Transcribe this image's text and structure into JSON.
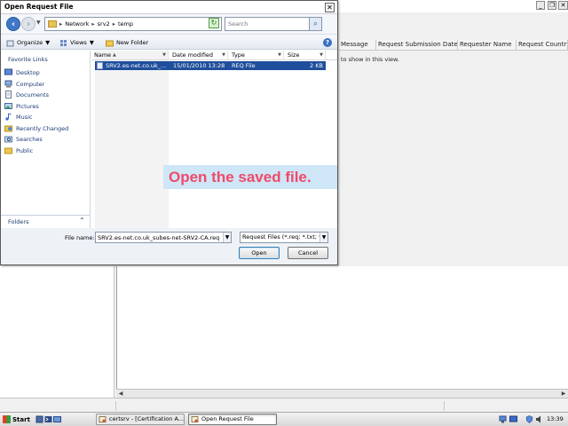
{
  "background_window": {
    "columns": [
      "Message",
      "Request Submission Date",
      "Requester Name",
      "Request Country/R"
    ],
    "empty_message": "to show in this view.",
    "title_controls": [
      "_",
      "❐",
      "✕"
    ]
  },
  "dialog": {
    "title": "Open Request File",
    "close": "✕",
    "breadcrumb": [
      "Network",
      "srv2",
      "temp"
    ],
    "breadcrumb_separator": "▸",
    "search_placeholder": "Search",
    "commands": {
      "organize": "Organize",
      "views": "Views",
      "new_folder": "New Folder",
      "dropdown_glyph": "▼"
    },
    "favorites_heading": "Favorite Links",
    "favorites": [
      "Desktop",
      "Computer",
      "Documents",
      "Pictures",
      "Music",
      "Recently Changed",
      "Searches",
      "Public"
    ],
    "folders_label": "Folders",
    "folders_chevron": "⌃",
    "columns": [
      "Name",
      "Date modified",
      "Type",
      "Size"
    ],
    "sort_glyph": "▲",
    "files": [
      {
        "name": "SRV2.es-net.co.uk_...",
        "date": "15/01/2010 13:28",
        "type": "REQ File",
        "size": "2 KB"
      }
    ],
    "file_name_label": "File name:",
    "file_name_value": "SRV2.es-net.co.uk_subes-net-SRV2-CA.req",
    "file_type_value": "Request Files (*.req; *.txt; *.cm",
    "open_label": "Open",
    "cancel_label": "Cancel"
  },
  "callout": {
    "text": "Open the saved file.",
    "text_color": "#f04a6a",
    "background_color": "#cfe6f6"
  },
  "taskbar": {
    "start_label": "Start",
    "tasks": [
      "certsrv - [Certification A...",
      "Open Request File"
    ],
    "clock": "13:39"
  },
  "colors": {
    "selection": "#1f4e9c",
    "link_text": "#1c3a78"
  }
}
